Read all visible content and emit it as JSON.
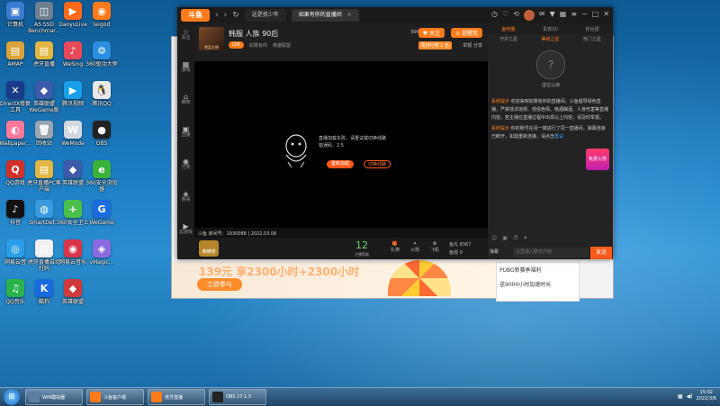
{
  "desktop": {
    "icons": [
      {
        "label": "计算机",
        "color": "#3b7bd1",
        "glyph": "▣"
      },
      {
        "label": "AS SSD Benchmar...",
        "color": "#6f7f90",
        "glyph": "◫"
      },
      {
        "label": "DaoyuLive",
        "color": "#ff6a1a",
        "glyph": "▶"
      },
      {
        "label": "leigod",
        "color": "#ff7a1a",
        "glyph": "◉"
      },
      {
        "label": "AMAP",
        "color": "#d9a43a",
        "glyph": "▤"
      },
      {
        "label": "虎牙直播",
        "color": "#e2b640",
        "glyph": "▤"
      },
      {
        "label": "WeSing",
        "color": "#e94a5a",
        "glyph": "♪"
      },
      {
        "label": "360驱动大师",
        "color": "#2a8fe0",
        "glyph": "⚙"
      },
      {
        "label": "DirectX修复工具",
        "color": "#1a3a8a",
        "glyph": "✕"
      },
      {
        "label": "英雄联盟WeGame版",
        "color": "#3d5ba8",
        "glyph": "◆"
      },
      {
        "label": "腾讯视频",
        "color": "#1aa0e8",
        "glyph": "▶"
      },
      {
        "label": "腾讯QQ",
        "color": "#e8e8e8",
        "glyph": "🐧"
      },
      {
        "label": "Wallpaper...",
        "color": "#ff7a9a",
        "glyph": "◐"
      },
      {
        "label": "回收站",
        "color": "#9aa5b0",
        "glyph": "🗑"
      },
      {
        "label": "WeMode",
        "color": "#d0d8e0",
        "glyph": "W"
      },
      {
        "label": "OBS",
        "color": "#222",
        "glyph": "●"
      },
      {
        "label": "QQ游戏",
        "color": "#d0302a",
        "glyph": "Q"
      },
      {
        "label": "虎牙直播PC客户端",
        "color": "#e2b640",
        "glyph": "▤"
      },
      {
        "label": "英雄联盟",
        "color": "#3d5ba8",
        "glyph": "◆"
      },
      {
        "label": "360安全浏览器",
        "color": "#3ab23a",
        "glyph": "e"
      },
      {
        "label": "抖音",
        "color": "#111",
        "glyph": "♪"
      },
      {
        "label": "SmartDef...",
        "color": "#3a9ae0",
        "glyph": "◍"
      },
      {
        "label": "360安全卫士",
        "color": "#4ac14a",
        "glyph": "+"
      },
      {
        "label": "WeGame",
        "color": "#1a6ae0",
        "glyph": "G"
      },
      {
        "label": "网易云音",
        "color": "#2a9ee8",
        "glyph": "◎"
      },
      {
        "label": "虎牙直播自动打码",
        "color": "#f0f0f0",
        "glyph": "▤"
      },
      {
        "label": "网易云音乐",
        "color": "#d8344a",
        "glyph": "◉"
      },
      {
        "label": "vMagic...",
        "color": "#8a6ae0",
        "glyph": "◈"
      },
      {
        "label": "QQ音乐",
        "color": "#2ab34a",
        "glyph": "♫"
      },
      {
        "label": "酷狗",
        "color": "#1a6ae0",
        "glyph": "K"
      },
      {
        "label": "英雄联盟",
        "color": "#d03a3a",
        "glyph": "◆"
      }
    ]
  },
  "app": {
    "logo": "斗鱼",
    "tabs": [
      {
        "label": "这是我少年"
      },
      {
        "label": "如果有你的直播间",
        "active": true
      }
    ],
    "leftbar": [
      {
        "icon": "☆",
        "label": "关注"
      },
      {
        "icon": "▦",
        "label": "游戏"
      },
      {
        "icon": "⌂",
        "label": "推荐"
      },
      {
        "icon": "▣",
        "label": "直播"
      },
      {
        "icon": "◉",
        "label": "分类"
      },
      {
        "icon": "◈",
        "label": "赛事"
      },
      {
        "icon": "▶",
        "label": "云游戏"
      }
    ],
    "stream": {
      "title": "韩服 人族 90后",
      "thumb_text": "雪梨主播",
      "level_badge": "LV6",
      "anchor": "如果有你",
      "category": "英雄联盟",
      "follow_label": "♥ 关注",
      "alert_label": "⊙ 提醒我",
      "viewer_count": "896",
      "rank_label": "周排行榜 1 名",
      "share_label": "举报 分享"
    },
    "video": {
      "msg_line1": "直播加载失败，请重试或切换线路",
      "msg_line2": "错误码：2.5",
      "refresh_label": "重新加载",
      "report_label": "切换线路",
      "roominfo": "斗鱼 房间号：1930088 | 2022.03.06"
    },
    "bottom": {
      "trophy_label": "荣耀榜",
      "level": "12",
      "level_label": "主播等级",
      "gifts": [
        {
          "icon": "🎁",
          "label": "礼物"
        },
        {
          "icon": "✦",
          "label": "火箭"
        },
        {
          "icon": "✿",
          "label": "飞机"
        }
      ],
      "fish_line1": "鱼丸 8367",
      "fish_line2": "鱼翅 0"
    },
    "chat": {
      "tabs1": [
        {
          "label": "鱼吧圈",
          "on": true
        },
        {
          "label": "贵宾(0)"
        },
        {
          "label": "粉丝团"
        }
      ],
      "tabs2": [
        {
          "label": "守护之星"
        },
        {
          "label": "等级之星",
          "on": true
        },
        {
          "label": "热门之星"
        }
      ],
      "guard_label": "虚位以待",
      "sys1_tag": "系统提示",
      "sys1_text": "欢迎来到如果有你的直播间，斗鱼倡导绿色直播，严禁违法违规、低俗色情、吸烟酗酒、人身伤害等直播内容。若主播在直播过程中出现以上内容，请及时举报。",
      "sys2_tag": "系统提示",
      "sys2_text": "你的账号在另一端进行了同一直播间，弹幕连接已断开，如需重新连接，请点击",
      "sys2_link": "重试",
      "hot_label": "免费火箭",
      "input_placeholder": "这里输入聊天内容",
      "send_label": "发送",
      "danmu_label": "弹幕"
    }
  },
  "taskbar": {
    "items": [
      {
        "label": "WIN模拟器",
        "color": "#5a7fa0"
      },
      {
        "label": "斗鱼客户端",
        "color": "#ff7a1a"
      },
      {
        "label": "虎牙直播",
        "color": "#ff7a1a"
      },
      {
        "label": "OBS 27.1.3",
        "color": "#222"
      }
    ],
    "time": "15:02",
    "date": "2022/3/6"
  }
}
